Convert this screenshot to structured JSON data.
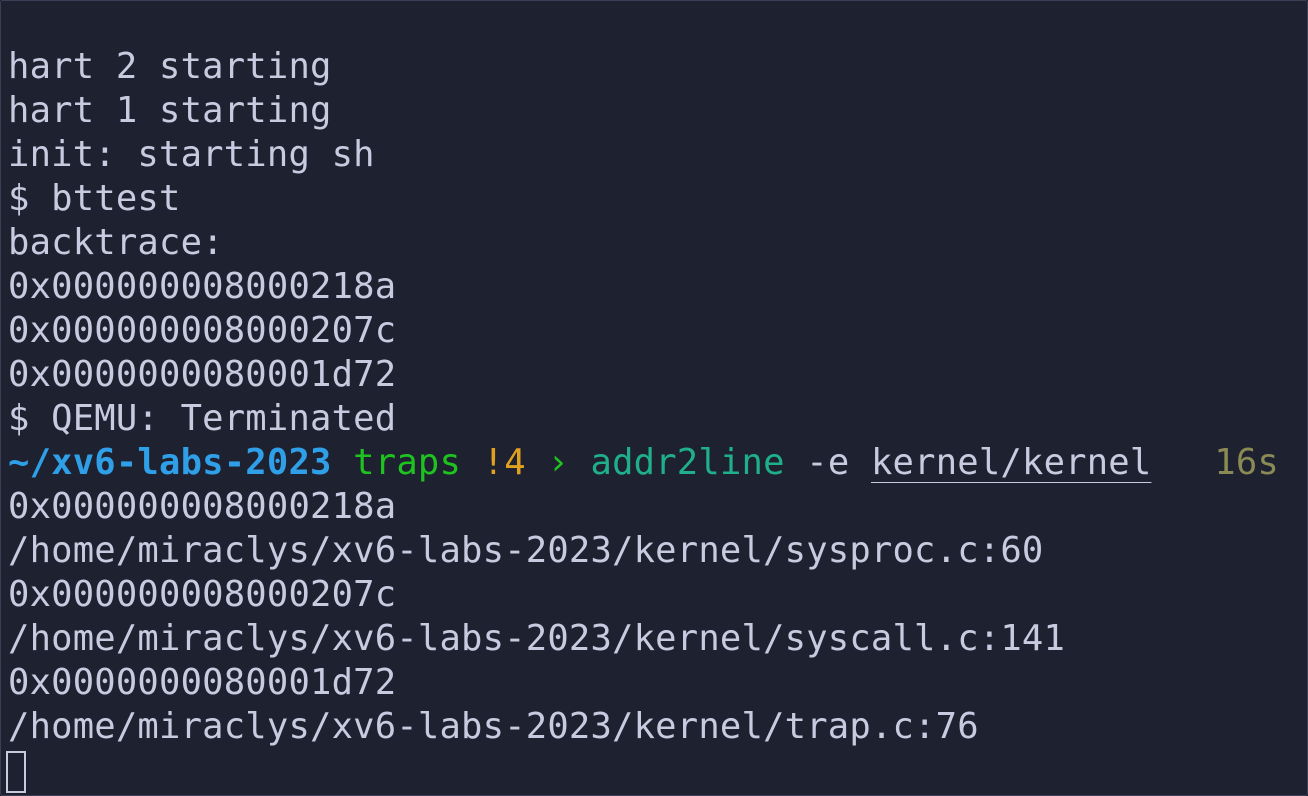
{
  "terminal": {
    "output_before": [
      "hart 2 starting",
      "hart 1 starting",
      "init: starting sh",
      "$ bttest",
      "backtrace:",
      "0x000000008000218a",
      "0x000000008000207c",
      "0x0000000080001d72",
      "$ QEMU: Terminated"
    ],
    "prompt": {
      "path": "~/xv6-labs-2023",
      "branch": "traps",
      "git_status": "!4",
      "arrow": "›",
      "command": "addr2line",
      "flag": "-e",
      "argument": "kernel/kernel",
      "duration": "16s"
    },
    "output_after": [
      "0x000000008000218a",
      "/home/miraclys/xv6-labs-2023/kernel/sysproc.c:60",
      "0x000000008000207c",
      "/home/miraclys/xv6-labs-2023/kernel/syscall.c:141",
      "0x0000000080001d72",
      "/home/miraclys/xv6-labs-2023/kernel/trap.c:76"
    ]
  },
  "colors": {
    "background": "#1e2130",
    "text": "#c8cbe0",
    "path": "#2f9fe8",
    "branch": "#1fc320",
    "git_status": "#e0a020",
    "command": "#1faf8a",
    "duration": "#8a8a55"
  }
}
